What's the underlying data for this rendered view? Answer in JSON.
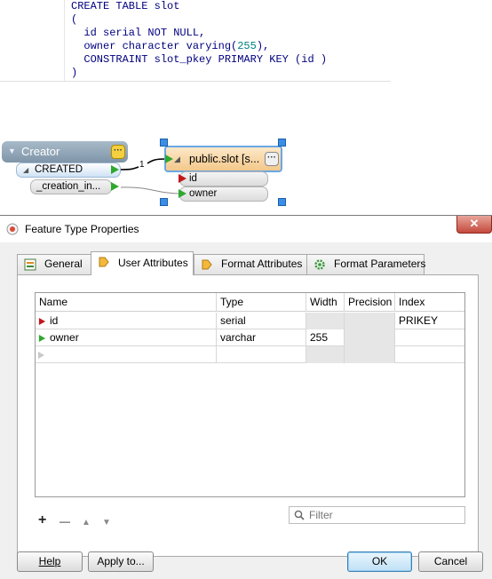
{
  "sql": {
    "lines": [
      "CREATE TABLE slot",
      "(",
      "  id serial NOT NULL,",
      "  owner character varying(",
      "),",
      "  CONSTRAINT slot_pkey PRIMARY KEY (id )",
      ")"
    ],
    "length_value": "255"
  },
  "workspace": {
    "creator_label": "Creator",
    "created_port": "CREATED",
    "creation_instance_port": "_creation_in...",
    "connection_count": "1",
    "feature_type_label": "public.slot [s...",
    "attr_id": "id",
    "attr_owner": "owner"
  },
  "dialog": {
    "title": "Feature Type Properties",
    "close_label": "✕",
    "tabs": [
      {
        "label": "General"
      },
      {
        "label": "User Attributes"
      },
      {
        "label": "Format Attributes"
      },
      {
        "label": "Format Parameters"
      }
    ],
    "grid": {
      "columns": [
        "Name",
        "Type",
        "Width",
        "Precision",
        "Index"
      ],
      "rows": [
        {
          "name": "id",
          "type": "serial",
          "width": "",
          "precision": "",
          "index": "PRIKEY"
        },
        {
          "name": "owner",
          "type": "varchar",
          "width": "255",
          "precision": "",
          "index": ""
        }
      ]
    },
    "toolbar": {
      "add": "+",
      "remove": "—",
      "up": "▲",
      "down": "▼"
    },
    "filter_placeholder": "Filter",
    "buttons": {
      "help": "Help",
      "apply_to": "Apply to...",
      "ok": "OK",
      "cancel": "Cancel"
    }
  },
  "colors": {
    "selection_blue": "#3a8ee6",
    "port_green": "#2fa82f",
    "key_red": "#c0181c",
    "sql_keyword": "#000080",
    "sql_number": "#008080"
  }
}
